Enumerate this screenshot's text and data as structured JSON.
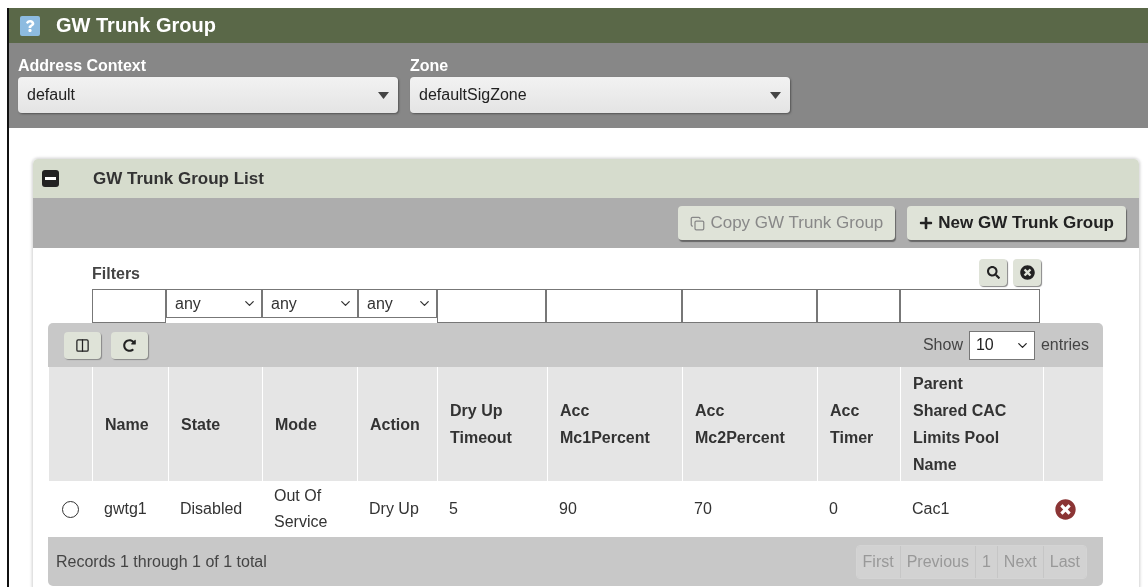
{
  "header": {
    "title": "GW Trunk Group"
  },
  "selectors": [
    {
      "label": "Address Context",
      "value": "default"
    },
    {
      "label": "Zone",
      "value": "defaultSigZone"
    }
  ],
  "panel": {
    "title": "GW Trunk Group List",
    "expanded": true,
    "buttons": [
      {
        "kind": "copy",
        "label": "Copy GW Trunk Group",
        "disabled": true
      },
      {
        "kind": "new",
        "label": "New GW Trunk Group",
        "disabled": false
      }
    ],
    "filters": {
      "label": "Filters",
      "fields": [
        {
          "kind": "text"
        },
        {
          "kind": "select",
          "value": "any"
        },
        {
          "kind": "select",
          "value": "any"
        },
        {
          "kind": "select",
          "value": "any"
        },
        {
          "kind": "text"
        },
        {
          "kind": "text"
        },
        {
          "kind": "text"
        },
        {
          "kind": "text"
        },
        {
          "kind": "text"
        }
      ]
    }
  },
  "page_size": {
    "label": "Show",
    "value": "10",
    "suffix": "entries"
  },
  "table": {
    "columns": [
      "",
      "Name",
      "State",
      "Mode",
      "Action",
      "Dry Up\nTimeout",
      "Acc\nMc1Percent",
      "Acc\nMc2Percent",
      "Acc\nTimer",
      "Parent\nShared CAC\nLimits Pool\nName",
      ""
    ],
    "rows": [
      {
        "selected": false,
        "cells": [
          "",
          "gwtg1",
          "Disabled",
          "Out Of\nService",
          "Dry Up",
          "5",
          "90",
          "70",
          "0",
          "Cac1",
          ""
        ]
      }
    ]
  },
  "footer": {
    "summary": "Records 1 through 1 of 1 total",
    "pages": [
      {
        "label": "First",
        "disabled": true
      },
      {
        "label": "Previous",
        "disabled": true
      },
      {
        "label": "1",
        "disabled": true
      },
      {
        "label": "Next",
        "disabled": true
      },
      {
        "label": "Last",
        "disabled": true
      }
    ]
  }
}
